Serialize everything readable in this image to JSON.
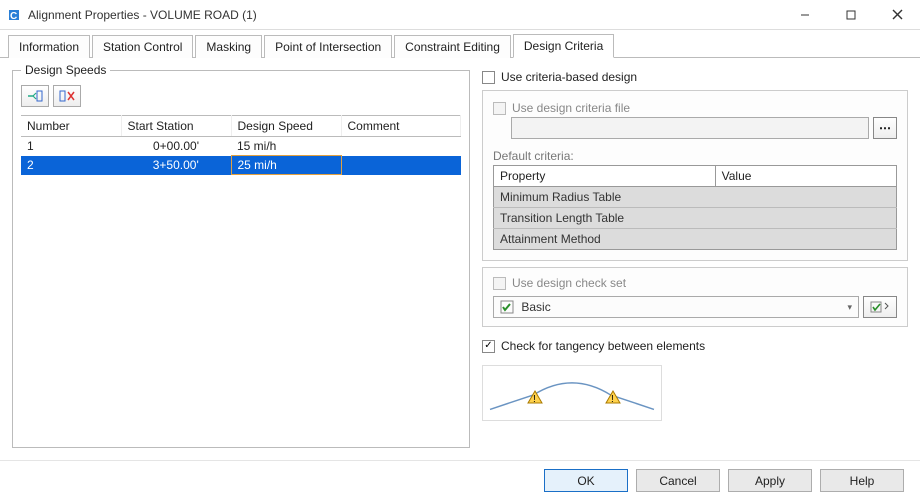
{
  "window": {
    "title": "Alignment Properties - VOLUME ROAD (1)"
  },
  "tabs": [
    "Information",
    "Station Control",
    "Masking",
    "Point of Intersection",
    "Constraint Editing",
    "Design Criteria"
  ],
  "active_tab": 5,
  "design_speeds": {
    "groupbox_label": "Design Speeds",
    "columns": [
      "Number",
      "Start Station",
      "Design Speed",
      "Comment"
    ],
    "rows": [
      {
        "number": "1",
        "start_station": "0+00.00'",
        "speed": "15 mi/h",
        "comment": ""
      },
      {
        "number": "2",
        "start_station": "3+50.00'",
        "speed": "25 mi/h",
        "comment": ""
      }
    ],
    "selected_row": 1
  },
  "right": {
    "use_criteria_label": "Use criteria-based design",
    "use_criteria_checked": false,
    "use_file_label": "Use design criteria file",
    "use_file_checked": false,
    "file_value": "",
    "default_criteria_label": "Default criteria:",
    "criteria_columns": [
      "Property",
      "Value"
    ],
    "criteria_rows": [
      {
        "property": "Minimum Radius Table",
        "value": ""
      },
      {
        "property": "Transition Length Table",
        "value": ""
      },
      {
        "property": "Attainment Method",
        "value": ""
      }
    ],
    "use_check_set_label": "Use design check set",
    "use_check_set_checked": false,
    "check_set_value": "Basic",
    "tangency_label": "Check for tangency between elements",
    "tangency_checked": true
  },
  "footer": {
    "ok": "OK",
    "cancel": "Cancel",
    "apply": "Apply",
    "help": "Help"
  }
}
